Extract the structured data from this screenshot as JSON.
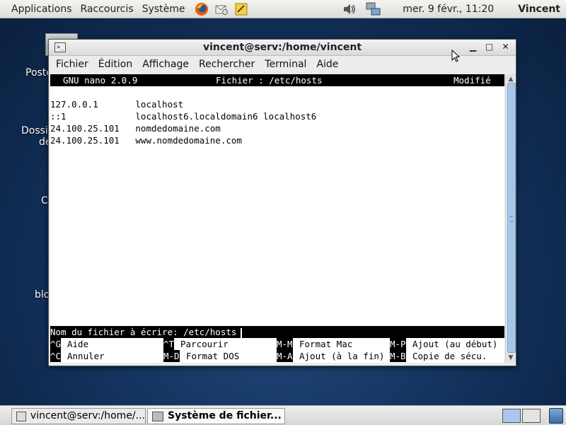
{
  "topbar": {
    "menus": [
      "Applications",
      "Raccourcis",
      "Système"
    ],
    "clock": "mer.  9 févr., 11:20",
    "user": "Vincent"
  },
  "desktop": {
    "labels": [
      "Poste",
      "Dossie",
      "de",
      "C",
      "blo"
    ]
  },
  "window": {
    "title": "vincent@serv:/home/vincent",
    "menubar": [
      "Fichier",
      "Édition",
      "Affichage",
      "Rechercher",
      "Terminal",
      "Aide"
    ]
  },
  "nano": {
    "version": "GNU nano 2.0.9",
    "file": "Fichier : /etc/hosts",
    "status": "Modifié",
    "lines": [
      "",
      "127.0.0.1       localhost",
      "::1             localhost6.localdomain6 localhost6",
      "24.100.25.101   nomdedomaine.com",
      "24.100.25.101   www.nomdedomaine.com"
    ],
    "prompt": "Nom du fichier à écrire: /etc/hosts",
    "shortcuts_row1": [
      {
        "key": "^G",
        "label": "Aide"
      },
      {
        "key": "^T",
        "label": "Parcourir"
      },
      {
        "key": "M-M",
        "label": "Format Mac"
      },
      {
        "key": "M-P",
        "label": "Ajout (au début)"
      }
    ],
    "shortcuts_row2": [
      {
        "key": "^C",
        "label": "Annuler"
      },
      {
        "key": "M-D",
        "label": "Format DOS"
      },
      {
        "key": "M-A",
        "label": "Ajout (à la fin)"
      },
      {
        "key": "M-B",
        "label": "Copie de sécu."
      }
    ]
  },
  "taskbar": {
    "tasks": [
      "vincent@serv:/home/...",
      "Système de fichier..."
    ]
  }
}
